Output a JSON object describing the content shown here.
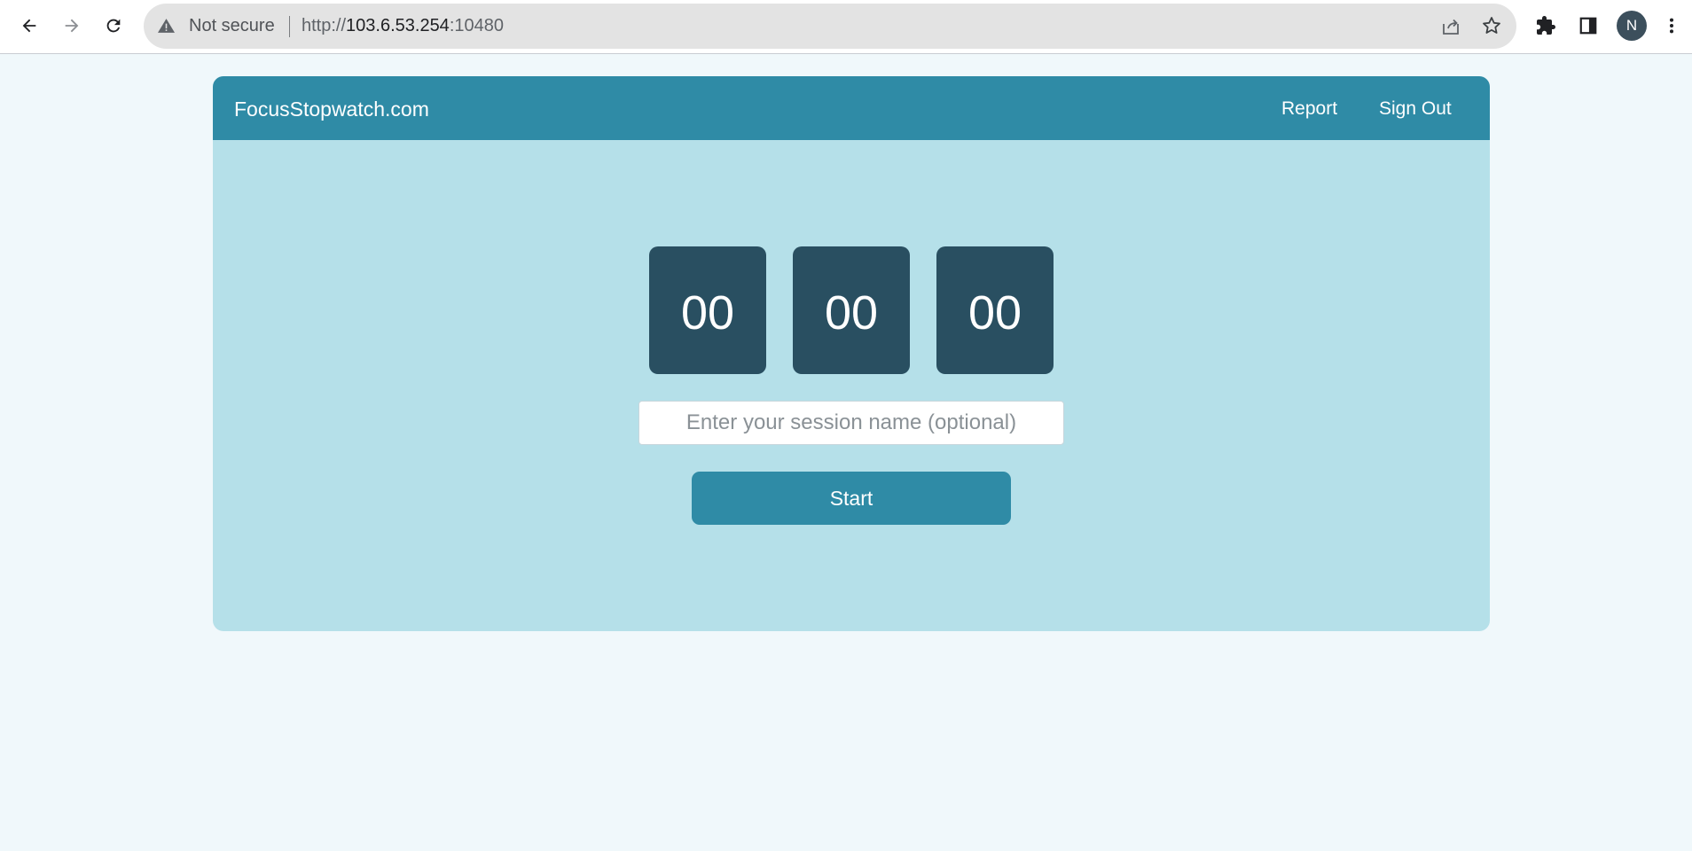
{
  "browser": {
    "security_label": "Not secure",
    "url_scheme": "http://",
    "url_host": "103.6.53.254",
    "url_port": ":10480",
    "profile_initial": "N",
    "icons": [
      "back-arrow-icon",
      "forward-arrow-icon",
      "reload-icon",
      "warning-icon",
      "share-icon",
      "star-icon",
      "extensions-puzzle-icon",
      "side-panel-icon",
      "kebab-menu-icon"
    ]
  },
  "navbar": {
    "brand": "FocusStopwatch.com",
    "links": [
      {
        "label": "Report"
      },
      {
        "label": "Sign Out"
      }
    ]
  },
  "timer": {
    "hours": "00",
    "minutes": "00",
    "seconds": "00"
  },
  "session": {
    "placeholder": "Enter your session name (optional)",
    "value": ""
  },
  "actions": {
    "start_label": "Start"
  },
  "colors": {
    "page_background": "#f0f8fb",
    "card_background": "#b5e0e9",
    "navbar": "#2f8ba6",
    "timer_box": "#294f61",
    "start_button": "#2f8ba6",
    "avatar": "#3c4f5c"
  }
}
